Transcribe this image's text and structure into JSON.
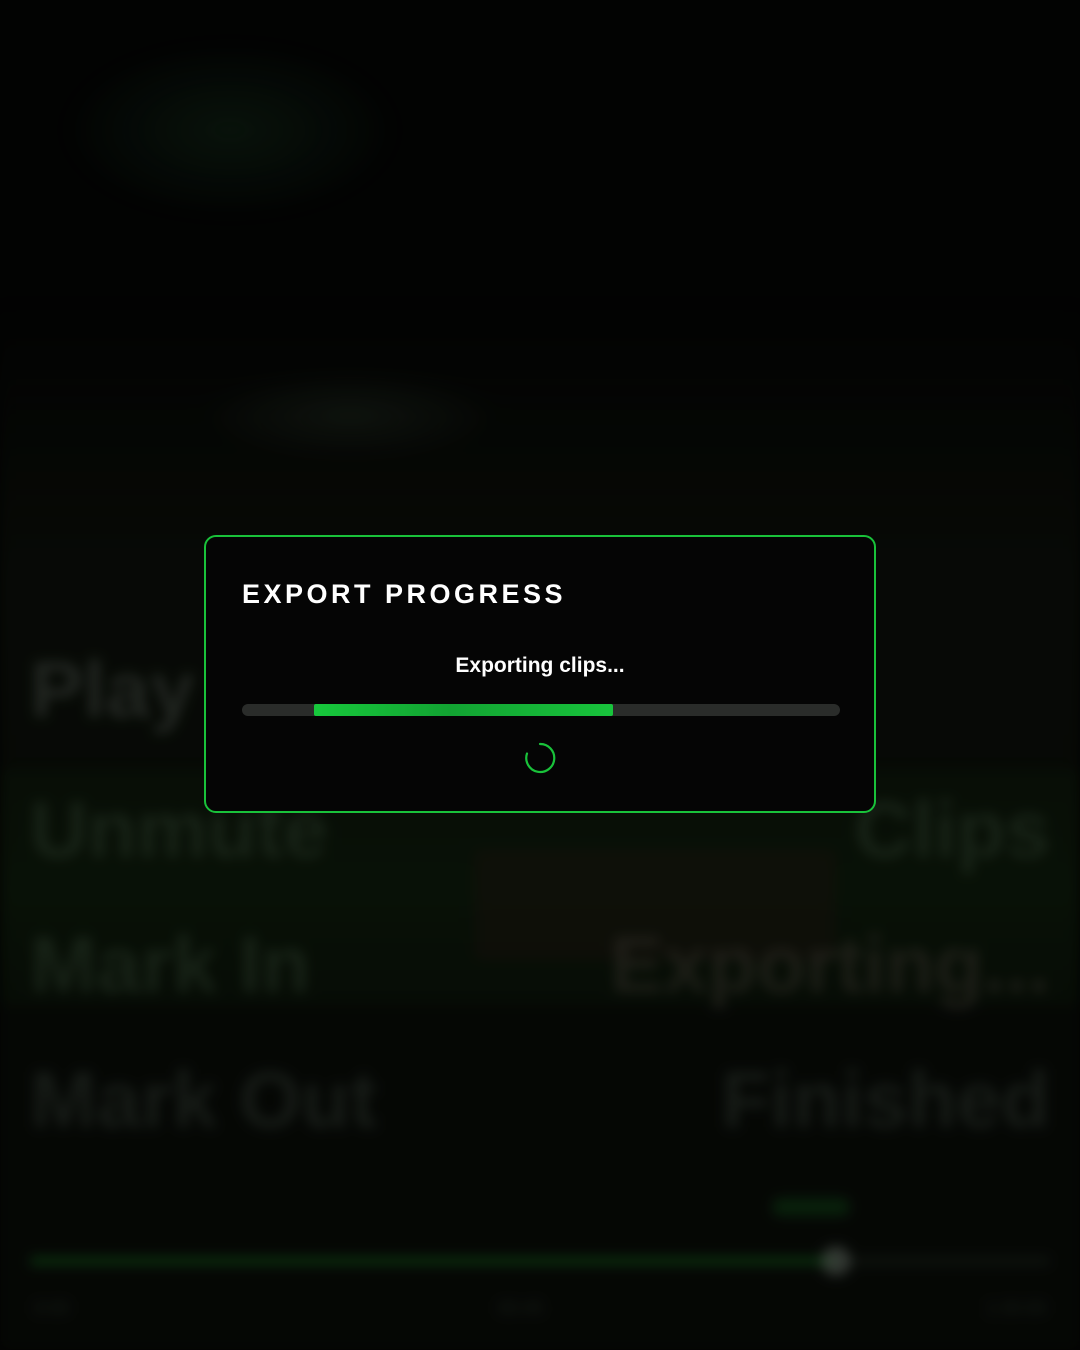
{
  "background": {
    "left_labels": [
      "Play",
      "Unmute",
      "Mark In",
      "Mark Out"
    ],
    "right_labels": [
      "Clips",
      "Exporting...",
      "Finished"
    ],
    "seek": {
      "progress": 0.79,
      "time_start": "0:00",
      "time_mid": "00:45",
      "time_end": "1:30:00"
    }
  },
  "modal": {
    "title": "EXPORT PROGRESS",
    "status": "Exporting clips...",
    "progress": {
      "start_fraction": 0.12,
      "end_fraction": 0.62
    },
    "accent_color": "#19c23a",
    "spinner_icon": "loading-spinner-icon"
  }
}
